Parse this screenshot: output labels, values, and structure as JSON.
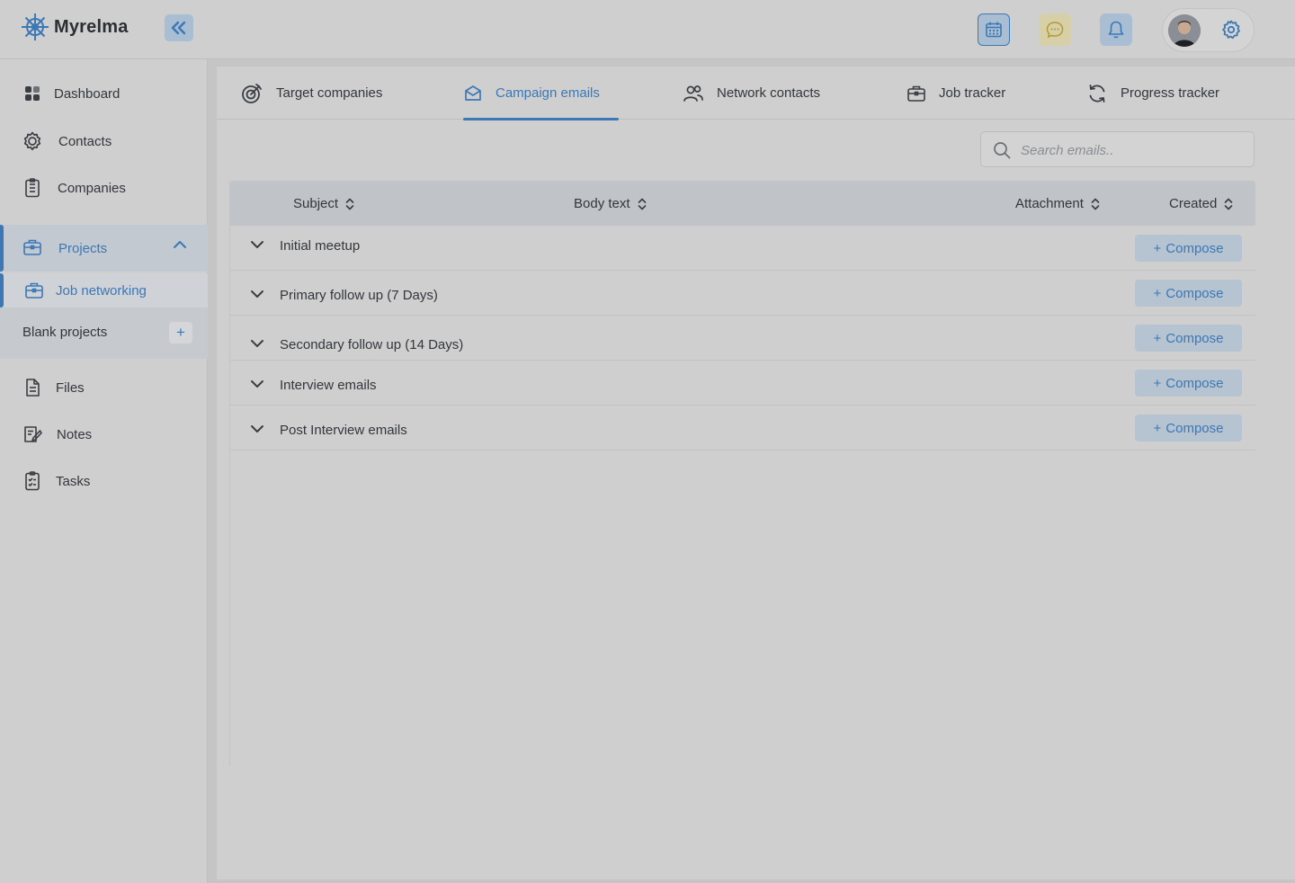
{
  "app": {
    "brand": "Myrelma"
  },
  "topbar": {
    "icons": [
      "calendar-icon",
      "chat-icon",
      "bell-icon",
      "gear-icon"
    ]
  },
  "sidebar": {
    "items": [
      {
        "label": "Dashboard",
        "icon": "dashboard-icon"
      },
      {
        "label": "Contacts",
        "icon": "contacts-icon"
      },
      {
        "label": "Companies",
        "icon": "companies-icon"
      },
      {
        "label": "Projects",
        "icon": "briefcase-icon"
      },
      {
        "label": "Job networking",
        "icon": "briefcase-icon"
      },
      {
        "label": "Blank projects"
      },
      {
        "label": "Files",
        "icon": "file-icon"
      },
      {
        "label": "Notes",
        "icon": "notes-icon"
      },
      {
        "label": "Tasks",
        "icon": "tasks-icon"
      }
    ],
    "blank_plus": "+"
  },
  "tabs": [
    {
      "label": "Target companies",
      "icon": "target-icon"
    },
    {
      "label": "Campaign emails",
      "icon": "mail-icon",
      "active": true
    },
    {
      "label": "Network contacts",
      "icon": "people-icon"
    },
    {
      "label": "Job tracker",
      "icon": "briefcase-icon"
    },
    {
      "label": "Progress tracker",
      "icon": "refresh-icon"
    }
  ],
  "search": {
    "placeholder": "Search emails.."
  },
  "table": {
    "columns": [
      "Subject",
      "Body text",
      "Attachment",
      "Created"
    ],
    "rows": [
      {
        "subject": "Initial meetup",
        "action": "Compose"
      },
      {
        "subject": "Primary follow up (7 Days)",
        "action": "Compose"
      },
      {
        "subject": "Secondary follow up (14 Days)",
        "action": "Compose"
      },
      {
        "subject": "Interview emails",
        "action": "Compose"
      },
      {
        "subject": "Post Interview emails",
        "action": "Compose"
      }
    ]
  },
  "colors": {
    "accent": "#3c78b5",
    "background": "#cfcfcf",
    "header": "#c0c3c7"
  }
}
